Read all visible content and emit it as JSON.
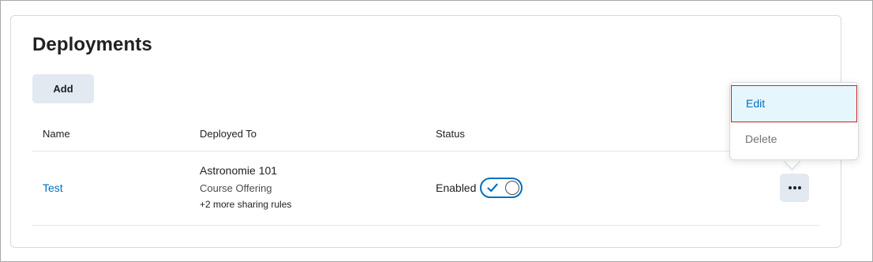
{
  "page": {
    "title": "Deployments",
    "add_label": "Add"
  },
  "table": {
    "columns": [
      "Name",
      "Deployed To",
      "Status"
    ],
    "rows": [
      {
        "name": "Test",
        "deployed_to": {
          "title": "Astronomie 101",
          "type": "Course Offering",
          "more": "+2 more sharing rules"
        },
        "status": "Enabled",
        "toggle_on": true
      }
    ]
  },
  "context_menu": {
    "items": [
      "Edit",
      "Delete"
    ],
    "highlighted": "Edit"
  },
  "icons": {
    "more": "more-horizontal-icon",
    "check": "checkmark-icon"
  },
  "colors": {
    "link": "#006fbf",
    "button_bg": "#e3e9f1",
    "highlight_bg": "#e6f6fd",
    "highlight_border": "#cd2026"
  }
}
